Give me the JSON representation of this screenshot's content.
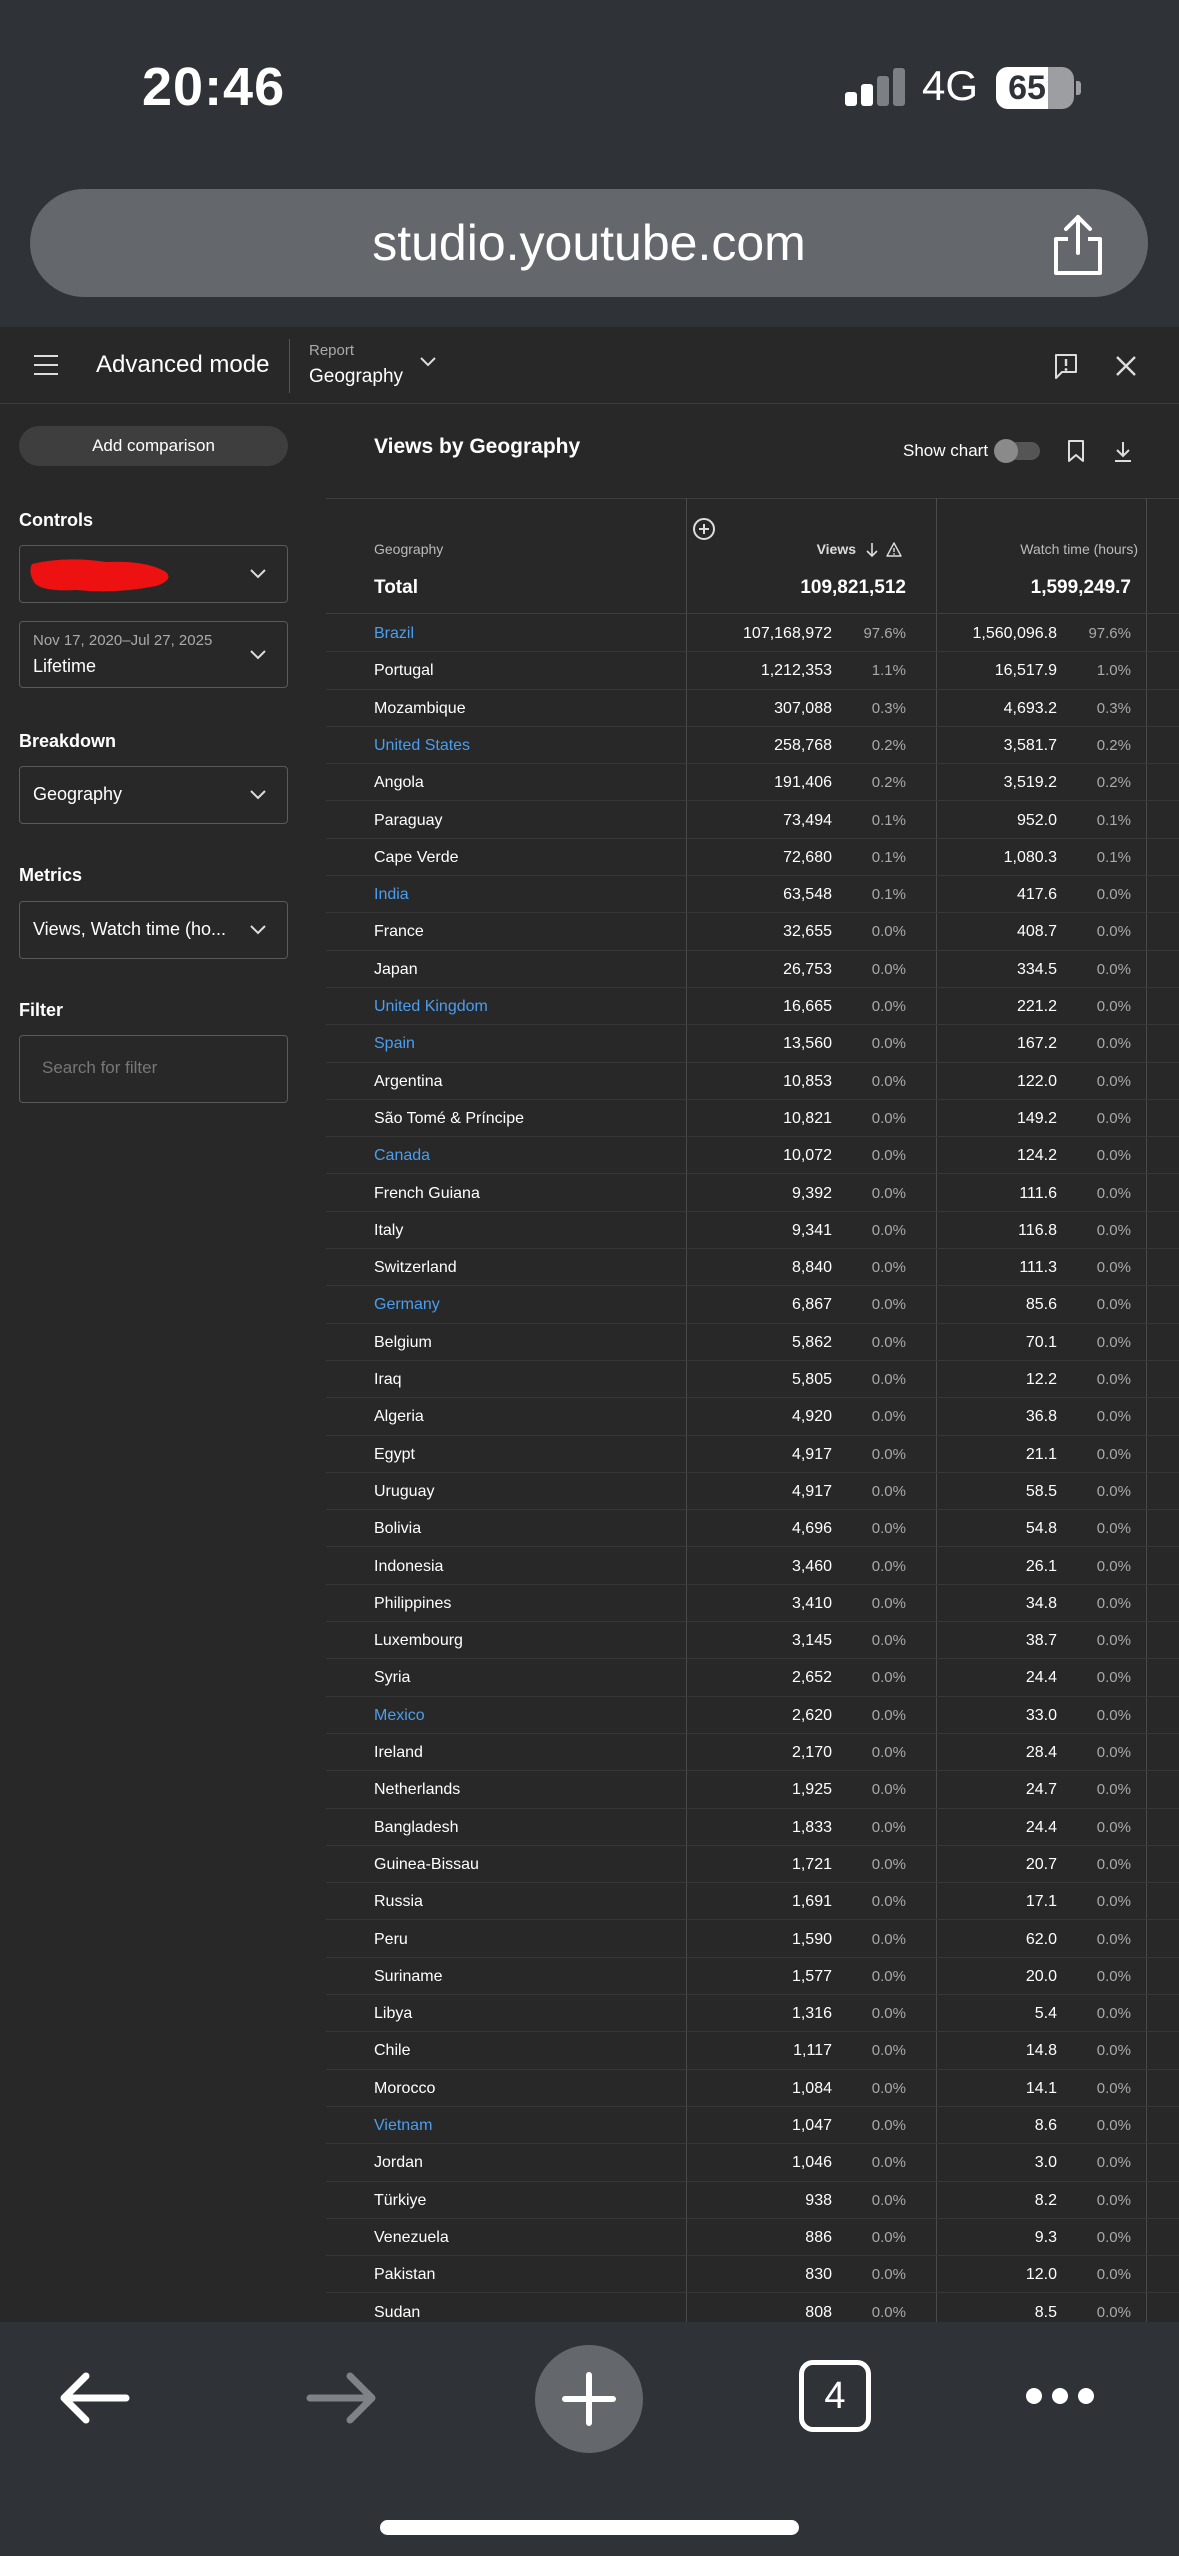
{
  "status_bar": {
    "time": "20:46",
    "network": "4G",
    "battery": "65"
  },
  "browser": {
    "url": "studio.youtube.com",
    "tab_count": "4"
  },
  "header": {
    "title": "Advanced mode",
    "report_label": "Report",
    "report_value": "Geography"
  },
  "sidebar": {
    "add_comparison": "Add comparison",
    "controls_label": "Controls",
    "date_range": "Nov 17, 2020–Jul 27, 2025",
    "period": "Lifetime",
    "breakdown_label": "Breakdown",
    "breakdown_value": "Geography",
    "metrics_label": "Metrics",
    "metrics_value": "Views, Watch time (ho...",
    "filter_label": "Filter",
    "filter_placeholder": "Search for filter"
  },
  "panel": {
    "title": "Views by Geography",
    "show_chart": "Show chart",
    "columns": {
      "geography": "Geography",
      "views": "Views",
      "watch_time": "Watch time (hours)"
    },
    "total": {
      "label": "Total",
      "views": "109,821,512",
      "watch_time": "1,599,249.7"
    },
    "rows": [
      {
        "country": "Brazil",
        "link": true,
        "views": "107,168,972",
        "views_pct": "97.6%",
        "watch": "1,560,096.8",
        "watch_pct": "97.6%"
      },
      {
        "country": "Portugal",
        "link": false,
        "views": "1,212,353",
        "views_pct": "1.1%",
        "watch": "16,517.9",
        "watch_pct": "1.0%"
      },
      {
        "country": "Mozambique",
        "link": false,
        "views": "307,088",
        "views_pct": "0.3%",
        "watch": "4,693.2",
        "watch_pct": "0.3%"
      },
      {
        "country": "United States",
        "link": true,
        "views": "258,768",
        "views_pct": "0.2%",
        "watch": "3,581.7",
        "watch_pct": "0.2%"
      },
      {
        "country": "Angola",
        "link": false,
        "views": "191,406",
        "views_pct": "0.2%",
        "watch": "3,519.2",
        "watch_pct": "0.2%"
      },
      {
        "country": "Paraguay",
        "link": false,
        "views": "73,494",
        "views_pct": "0.1%",
        "watch": "952.0",
        "watch_pct": "0.1%"
      },
      {
        "country": "Cape Verde",
        "link": false,
        "views": "72,680",
        "views_pct": "0.1%",
        "watch": "1,080.3",
        "watch_pct": "0.1%"
      },
      {
        "country": "India",
        "link": true,
        "views": "63,548",
        "views_pct": "0.1%",
        "watch": "417.6",
        "watch_pct": "0.0%"
      },
      {
        "country": "France",
        "link": false,
        "views": "32,655",
        "views_pct": "0.0%",
        "watch": "408.7",
        "watch_pct": "0.0%"
      },
      {
        "country": "Japan",
        "link": false,
        "views": "26,753",
        "views_pct": "0.0%",
        "watch": "334.5",
        "watch_pct": "0.0%"
      },
      {
        "country": "United Kingdom",
        "link": true,
        "views": "16,665",
        "views_pct": "0.0%",
        "watch": "221.2",
        "watch_pct": "0.0%"
      },
      {
        "country": "Spain",
        "link": true,
        "views": "13,560",
        "views_pct": "0.0%",
        "watch": "167.2",
        "watch_pct": "0.0%"
      },
      {
        "country": "Argentina",
        "link": false,
        "views": "10,853",
        "views_pct": "0.0%",
        "watch": "122.0",
        "watch_pct": "0.0%"
      },
      {
        "country": "São Tomé & Príncipe",
        "link": false,
        "views": "10,821",
        "views_pct": "0.0%",
        "watch": "149.2",
        "watch_pct": "0.0%"
      },
      {
        "country": "Canada",
        "link": true,
        "views": "10,072",
        "views_pct": "0.0%",
        "watch": "124.2",
        "watch_pct": "0.0%"
      },
      {
        "country": "French Guiana",
        "link": false,
        "views": "9,392",
        "views_pct": "0.0%",
        "watch": "111.6",
        "watch_pct": "0.0%"
      },
      {
        "country": "Italy",
        "link": false,
        "views": "9,341",
        "views_pct": "0.0%",
        "watch": "116.8",
        "watch_pct": "0.0%"
      },
      {
        "country": "Switzerland",
        "link": false,
        "views": "8,840",
        "views_pct": "0.0%",
        "watch": "111.3",
        "watch_pct": "0.0%"
      },
      {
        "country": "Germany",
        "link": true,
        "views": "6,867",
        "views_pct": "0.0%",
        "watch": "85.6",
        "watch_pct": "0.0%"
      },
      {
        "country": "Belgium",
        "link": false,
        "views": "5,862",
        "views_pct": "0.0%",
        "watch": "70.1",
        "watch_pct": "0.0%"
      },
      {
        "country": "Iraq",
        "link": false,
        "views": "5,805",
        "views_pct": "0.0%",
        "watch": "12.2",
        "watch_pct": "0.0%"
      },
      {
        "country": "Algeria",
        "link": false,
        "views": "4,920",
        "views_pct": "0.0%",
        "watch": "36.8",
        "watch_pct": "0.0%"
      },
      {
        "country": "Egypt",
        "link": false,
        "views": "4,917",
        "views_pct": "0.0%",
        "watch": "21.1",
        "watch_pct": "0.0%"
      },
      {
        "country": "Uruguay",
        "link": false,
        "views": "4,917",
        "views_pct": "0.0%",
        "watch": "58.5",
        "watch_pct": "0.0%"
      },
      {
        "country": "Bolivia",
        "link": false,
        "views": "4,696",
        "views_pct": "0.0%",
        "watch": "54.8",
        "watch_pct": "0.0%"
      },
      {
        "country": "Indonesia",
        "link": false,
        "views": "3,460",
        "views_pct": "0.0%",
        "watch": "26.1",
        "watch_pct": "0.0%"
      },
      {
        "country": "Philippines",
        "link": false,
        "views": "3,410",
        "views_pct": "0.0%",
        "watch": "34.8",
        "watch_pct": "0.0%"
      },
      {
        "country": "Luxembourg",
        "link": false,
        "views": "3,145",
        "views_pct": "0.0%",
        "watch": "38.7",
        "watch_pct": "0.0%"
      },
      {
        "country": "Syria",
        "link": false,
        "views": "2,652",
        "views_pct": "0.0%",
        "watch": "24.4",
        "watch_pct": "0.0%"
      },
      {
        "country": "Mexico",
        "link": true,
        "views": "2,620",
        "views_pct": "0.0%",
        "watch": "33.0",
        "watch_pct": "0.0%"
      },
      {
        "country": "Ireland",
        "link": false,
        "views": "2,170",
        "views_pct": "0.0%",
        "watch": "28.4",
        "watch_pct": "0.0%"
      },
      {
        "country": "Netherlands",
        "link": false,
        "views": "1,925",
        "views_pct": "0.0%",
        "watch": "24.7",
        "watch_pct": "0.0%"
      },
      {
        "country": "Bangladesh",
        "link": false,
        "views": "1,833",
        "views_pct": "0.0%",
        "watch": "24.4",
        "watch_pct": "0.0%"
      },
      {
        "country": "Guinea-Bissau",
        "link": false,
        "views": "1,721",
        "views_pct": "0.0%",
        "watch": "20.7",
        "watch_pct": "0.0%"
      },
      {
        "country": "Russia",
        "link": false,
        "views": "1,691",
        "views_pct": "0.0%",
        "watch": "17.1",
        "watch_pct": "0.0%"
      },
      {
        "country": "Peru",
        "link": false,
        "views": "1,590",
        "views_pct": "0.0%",
        "watch": "62.0",
        "watch_pct": "0.0%"
      },
      {
        "country": "Suriname",
        "link": false,
        "views": "1,577",
        "views_pct": "0.0%",
        "watch": "20.0",
        "watch_pct": "0.0%"
      },
      {
        "country": "Libya",
        "link": false,
        "views": "1,316",
        "views_pct": "0.0%",
        "watch": "5.4",
        "watch_pct": "0.0%"
      },
      {
        "country": "Chile",
        "link": false,
        "views": "1,117",
        "views_pct": "0.0%",
        "watch": "14.8",
        "watch_pct": "0.0%"
      },
      {
        "country": "Morocco",
        "link": false,
        "views": "1,084",
        "views_pct": "0.0%",
        "watch": "14.1",
        "watch_pct": "0.0%"
      },
      {
        "country": "Vietnam",
        "link": true,
        "views": "1,047",
        "views_pct": "0.0%",
        "watch": "8.6",
        "watch_pct": "0.0%"
      },
      {
        "country": "Jordan",
        "link": false,
        "views": "1,046",
        "views_pct": "0.0%",
        "watch": "3.0",
        "watch_pct": "0.0%"
      },
      {
        "country": "Türkiye",
        "link": false,
        "views": "938",
        "views_pct": "0.0%",
        "watch": "8.2",
        "watch_pct": "0.0%"
      },
      {
        "country": "Venezuela",
        "link": false,
        "views": "886",
        "views_pct": "0.0%",
        "watch": "9.3",
        "watch_pct": "0.0%"
      },
      {
        "country": "Pakistan",
        "link": false,
        "views": "830",
        "views_pct": "0.0%",
        "watch": "12.0",
        "watch_pct": "0.0%"
      },
      {
        "country": "Sudan",
        "link": false,
        "views": "808",
        "views_pct": "0.0%",
        "watch": "8.5",
        "watch_pct": "0.0%"
      }
    ]
  },
  "colors": {
    "link": "#4a9eef",
    "background": "#282828",
    "chrome": "#2f3236"
  }
}
